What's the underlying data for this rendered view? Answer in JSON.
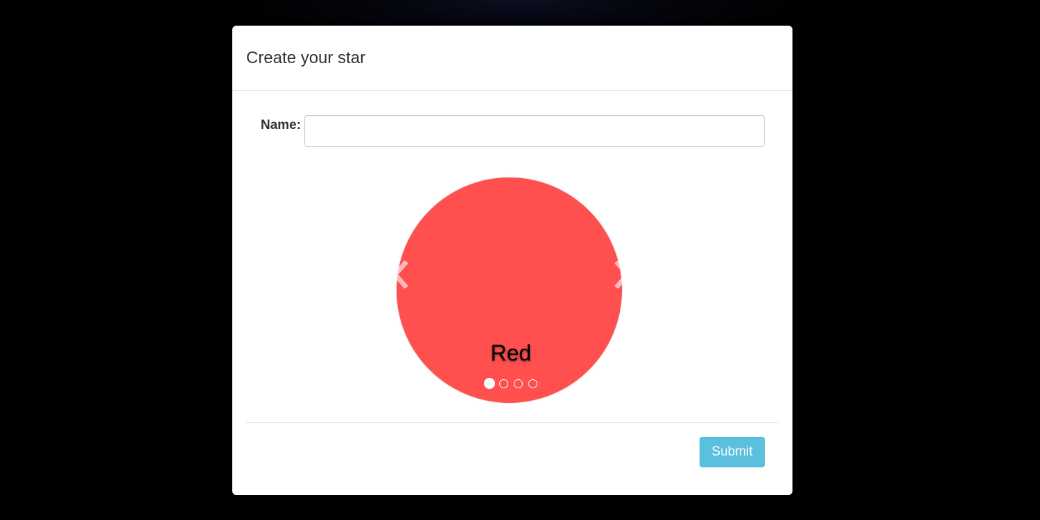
{
  "modal": {
    "title": "Create your star"
  },
  "form": {
    "name_label": "Name:",
    "name_value": "",
    "name_placeholder": ""
  },
  "carousel": {
    "current_caption": "Red",
    "current_color": "#ff4f4f",
    "slide_count": 4,
    "active_index": 0,
    "prev_icon": "chevron-left-icon",
    "next_icon": "chevron-right-icon"
  },
  "footer": {
    "submit_label": "Submit"
  },
  "colors": {
    "submit_button": "#5bc0de",
    "backdrop": "#000000",
    "modal_background": "#ffffff"
  }
}
